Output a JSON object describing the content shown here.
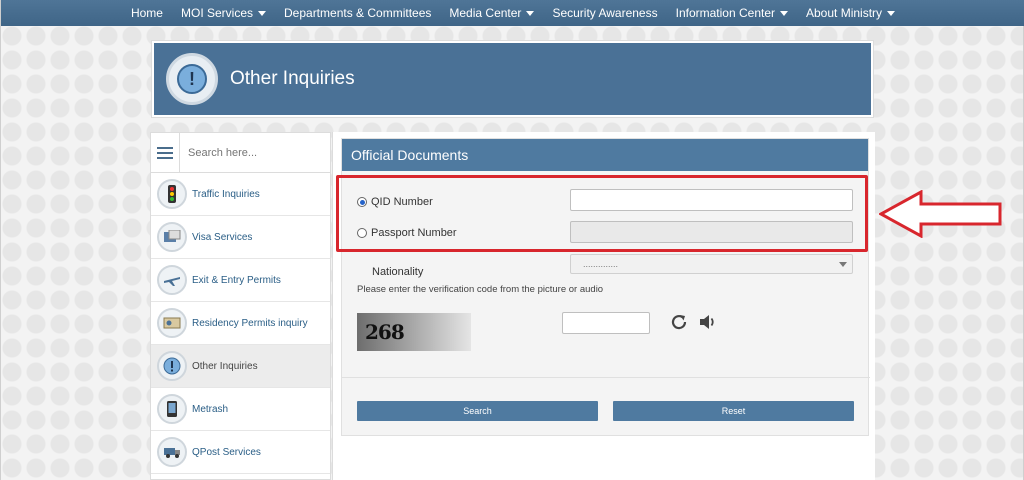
{
  "nav": {
    "items": [
      {
        "label": "Home",
        "dropdown": false
      },
      {
        "label": "MOI Services",
        "dropdown": true
      },
      {
        "label": "Departments & Committees",
        "dropdown": false
      },
      {
        "label": "Media Center",
        "dropdown": true
      },
      {
        "label": "Security Awareness",
        "dropdown": false
      },
      {
        "label": "Information Center",
        "dropdown": true
      },
      {
        "label": "About Ministry",
        "dropdown": true
      }
    ]
  },
  "banner": {
    "title": "Other Inquiries",
    "icon": "exclamation-bubble-icon"
  },
  "sidebar": {
    "search_placeholder": "Search here...",
    "items": [
      {
        "label": "Traffic Inquiries",
        "icon": "traffic-light-icon"
      },
      {
        "label": "Visa Services",
        "icon": "passport-icon"
      },
      {
        "label": "Exit & Entry Permits",
        "icon": "airplane-icon"
      },
      {
        "label": "Residency Permits inquiry",
        "icon": "id-card-icon"
      },
      {
        "label": "Other Inquiries",
        "icon": "exclamation-bubble-icon",
        "active": true
      },
      {
        "label": "Metrash",
        "icon": "mobile-phone-icon"
      },
      {
        "label": "QPost Services",
        "icon": "post-truck-icon"
      }
    ]
  },
  "form": {
    "title": "Official Documents",
    "qid_label": "QID Number",
    "passport_label": "Passport Number",
    "nationality_label": "Nationality",
    "nationality_value": "..............",
    "verification_text": "Please enter the verification code from the picture or audio",
    "captcha_text": "268",
    "search_label": "Search",
    "reset_label": "Reset"
  },
  "annotation": {
    "highlight_color": "#d8262d"
  }
}
